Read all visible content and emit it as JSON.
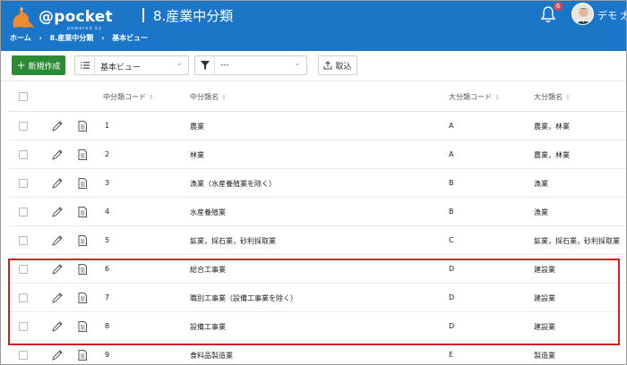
{
  "header": {
    "logo_text": "@pocket",
    "logo_sub": "powered by",
    "title": "8.産業中分類",
    "notification_count": "6",
    "user_name": "デモ 太郎"
  },
  "breadcrumb": [
    "ホーム",
    "›",
    "8.産業中分類",
    "›",
    "基本ビュー"
  ],
  "toolbar": {
    "new_label": "新規作成",
    "view_value": "基本ビュー",
    "filter_value": "---",
    "import_label": "取込"
  },
  "table": {
    "columns": [
      "中分類コード",
      "中分類名",
      "大分類コード",
      "大分類名"
    ],
    "rows": [
      {
        "code": "1",
        "name": "農業",
        "major_code": "A",
        "major_name": "農業，林業"
      },
      {
        "code": "2",
        "name": "林業",
        "major_code": "A",
        "major_name": "農業，林業"
      },
      {
        "code": "3",
        "name": "漁業（水産養殖業を除く）",
        "major_code": "B",
        "major_name": "漁業"
      },
      {
        "code": "4",
        "name": "水産養殖業",
        "major_code": "B",
        "major_name": "漁業"
      },
      {
        "code": "5",
        "name": "鉱業，採石業，砂利採取業",
        "major_code": "C",
        "major_name": "鉱業，採石業，砂利採取業"
      },
      {
        "code": "6",
        "name": "総合工事業",
        "major_code": "D",
        "major_name": "建設業"
      },
      {
        "code": "7",
        "name": "職別工事業（設備工事業を除く）",
        "major_code": "D",
        "major_name": "建設業"
      },
      {
        "code": "8",
        "name": "設備工事業",
        "major_code": "D",
        "major_name": "建設業"
      },
      {
        "code": "9",
        "name": "食料品製造業",
        "major_code": "E",
        "major_name": "製造業"
      }
    ]
  },
  "colors": {
    "header_bg": "#1b76c8",
    "new_button": "#2c8a34",
    "highlight": "#d51f1f"
  }
}
